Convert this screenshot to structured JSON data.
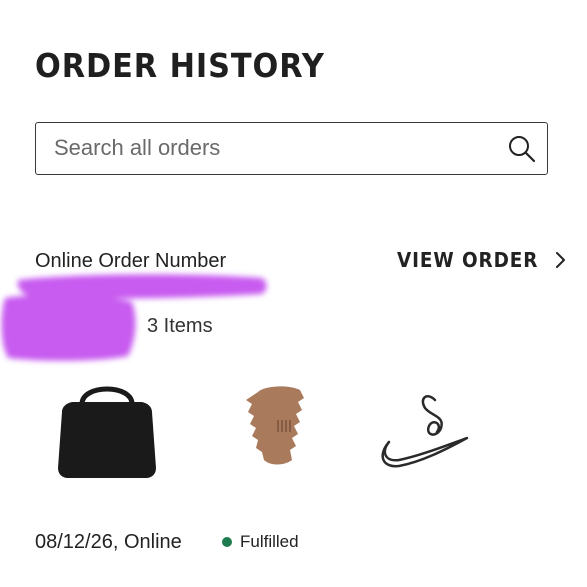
{
  "page": {
    "title": "ORDER HISTORY"
  },
  "search": {
    "placeholder": "Search all orders",
    "value": "",
    "icon": "search-icon"
  },
  "order": {
    "number_label": "Online Order Number",
    "view_order_label": "VIEW ORDER",
    "view_order_icon": "chevron-right-icon",
    "items_count": "3 Items",
    "date_and_channel": "08/12/26, Online",
    "status": "Fulfilled",
    "status_color": "#1e7a4f",
    "products": [
      {
        "icon": "bag-icon",
        "color": "#1a1a1a"
      },
      {
        "icon": "hair-clip-icon",
        "color": "#a97a5c"
      },
      {
        "icon": "swoosh-charm-icon",
        "color": "#2a2a2a"
      }
    ]
  },
  "colors": {
    "redaction": "#c85cf0",
    "text": "#222222",
    "border": "#3a3a3a"
  }
}
